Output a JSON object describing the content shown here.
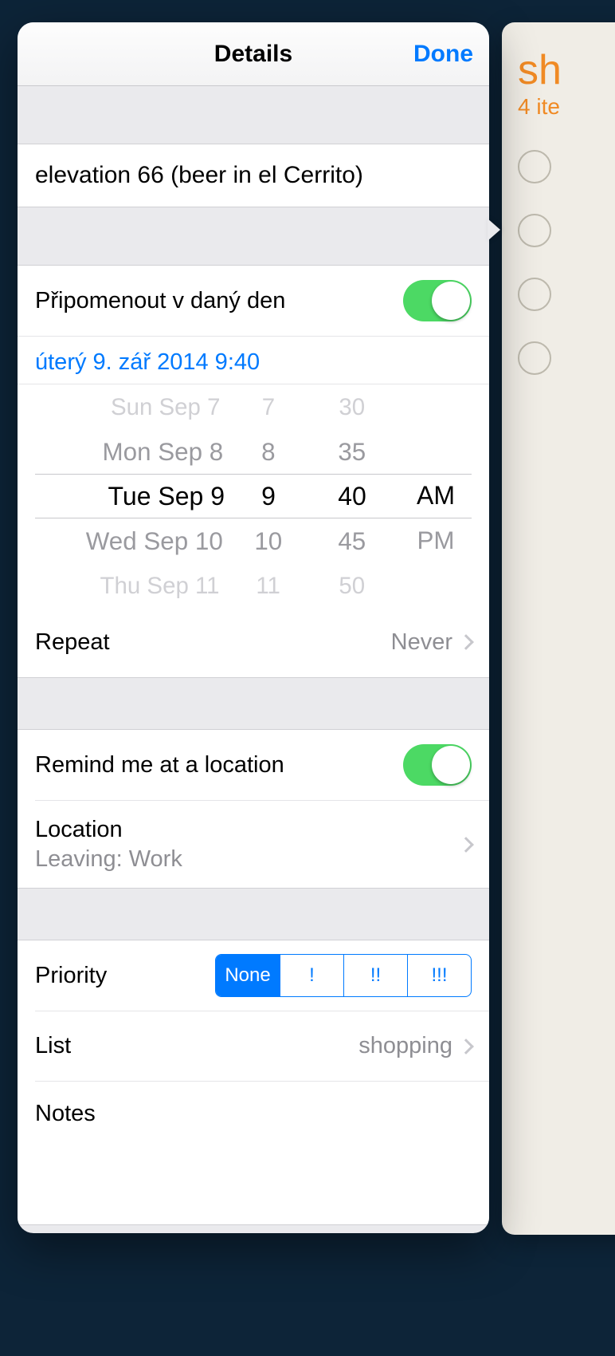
{
  "background": {
    "title": "sh",
    "subtitle": "4 ite"
  },
  "nav": {
    "title": "Details",
    "done": "Done"
  },
  "reminder": {
    "title": "elevation 66 (beer in el Cerrito)"
  },
  "remindDay": {
    "label": "Připomenout v daný den",
    "date_label": "úterý 9. zář 2014 9:40"
  },
  "picker": {
    "dates": [
      "Sun Sep 7",
      "Mon Sep 8",
      "Tue Sep 9",
      "Wed Sep 10",
      "Thu Sep 11"
    ],
    "hours": [
      "7",
      "8",
      "9",
      "10",
      "11"
    ],
    "mins": [
      "30",
      "35",
      "40",
      "45",
      "50"
    ],
    "ampm": [
      "",
      "",
      "AM",
      "PM",
      ""
    ]
  },
  "repeat": {
    "label": "Repeat",
    "value": "Never"
  },
  "remindLoc": {
    "label": "Remind me at a location"
  },
  "location": {
    "label": "Location",
    "detail": "Leaving: Work"
  },
  "priority": {
    "label": "Priority",
    "options": [
      "None",
      "!",
      "!!",
      "!!!"
    ],
    "selected": 0
  },
  "list": {
    "label": "List",
    "value": "shopping"
  },
  "notes": {
    "label": "Notes"
  }
}
